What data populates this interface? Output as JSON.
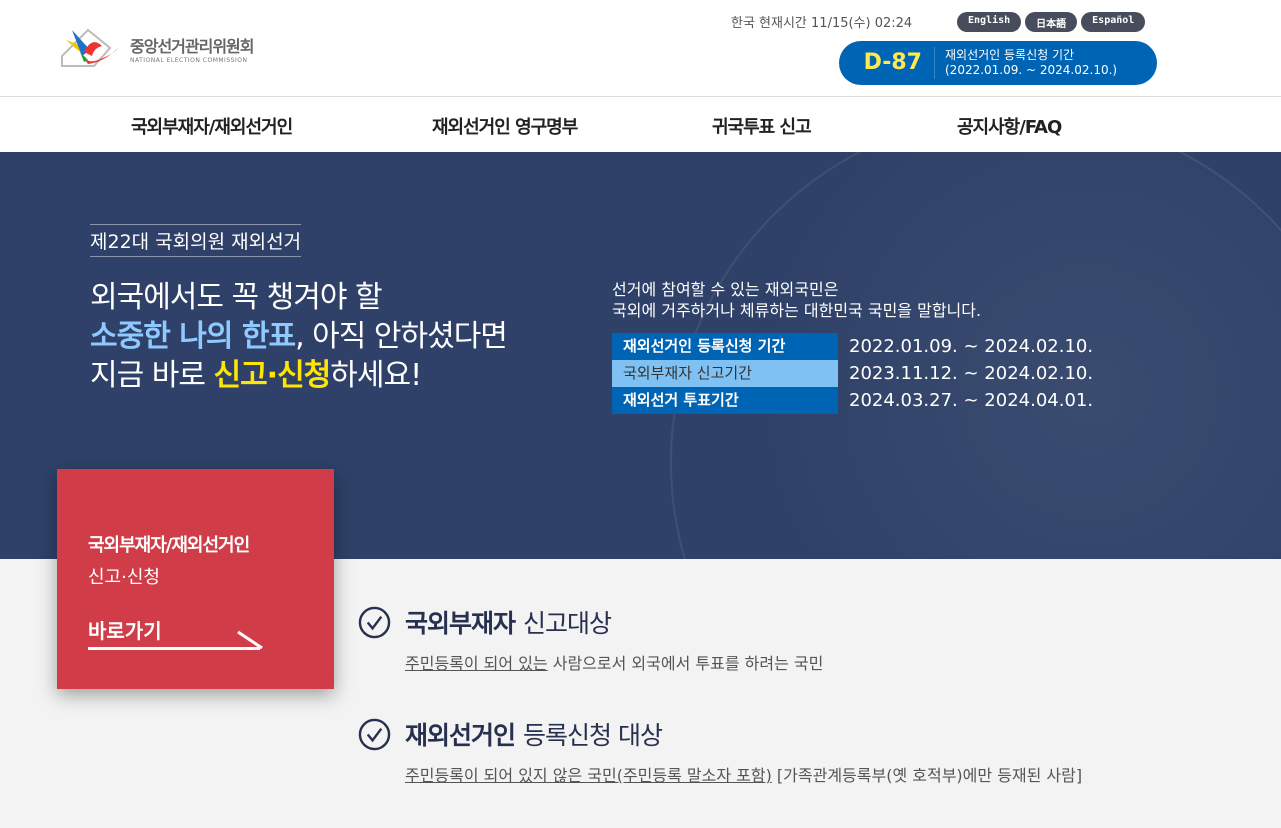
{
  "header": {
    "logo_ko": "중앙선거관리위원회",
    "logo_en": "NATIONAL ELECTION COMMISSION",
    "time": "한국 현재시간 11/15(수) 02:24",
    "languages": [
      "English",
      "日本語",
      "Español"
    ],
    "dday": {
      "count": "D-87",
      "label": "재외선거인 등록신청 기간",
      "range": "(2022.01.09. ~ 2024.02.10.)"
    }
  },
  "nav": [
    "국외부재자/재외선거인",
    "재외선거인 영구명부",
    "귀국투표 신고",
    "공지사항/FAQ"
  ],
  "banner": {
    "subtitle": "제22대 국회의원 재외선거",
    "line1": "외국에서도 꼭 챙겨야 할",
    "line2_hl": "소중한 나의 한표",
    "line2_rest": ", 아직 안하셨다면",
    "line3_pre": "지금 바로 ",
    "line3_hl": "신고·신청",
    "line3_post": "하세요!",
    "desc1": "선거에 참여할 수 있는 재외국민은",
    "desc2": "국외에 거주하거나 체류하는 대한민국 국민을 말합니다.",
    "periods": [
      {
        "label": "재외선거인 등록신청 기간",
        "dates": "2022.01.09. ~ 2024.02.10."
      },
      {
        "label": "국외부재자 신고기간",
        "dates": "2023.11.12. ~ 2024.02.10."
      },
      {
        "label": "재외선거 투표기간",
        "dates": "2024.03.27. ~ 2024.04.01."
      }
    ]
  },
  "card": {
    "title": "국외부재자/재외선거인",
    "subtitle": "신고·신청",
    "go": "바로가기"
  },
  "targets": [
    {
      "bold": "국외부재자",
      "rest": "신고대상",
      "underlined": "주민등록이 되어 있는",
      "desc": " 사람으로서 외국에서 투표를 하려는 국민"
    },
    {
      "bold": "재외선거인",
      "rest": "등록신청 대상",
      "underlined": "주민등록이 되어 있지 않은 국민(주민등록 말소자 포함)",
      "desc": " [가족관계등록부(옛 호적부)에만 등재된 사람]"
    }
  ]
}
